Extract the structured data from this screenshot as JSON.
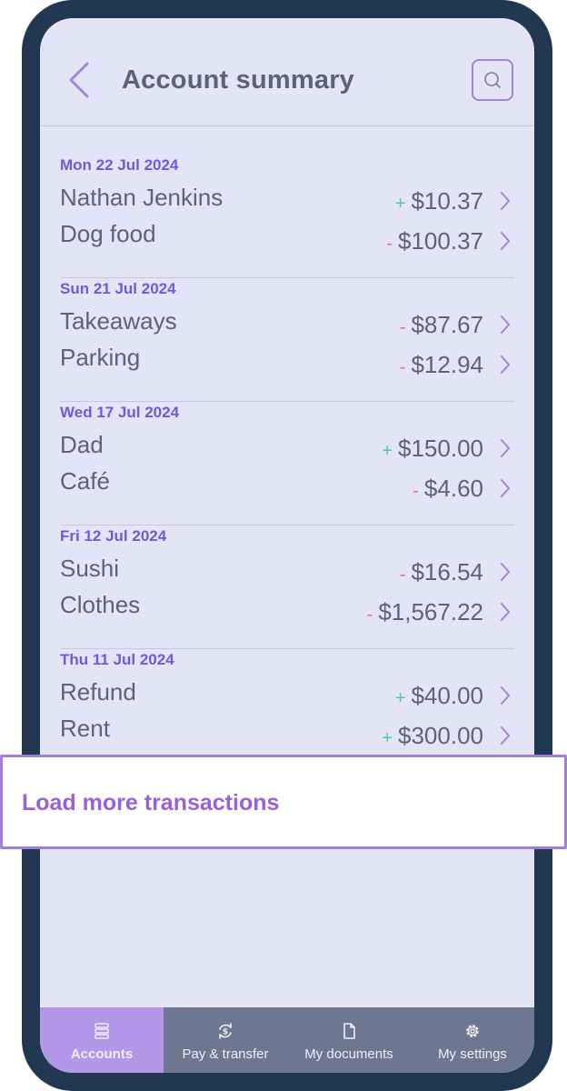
{
  "header": {
    "title": "Account summary"
  },
  "transactions": [
    {
      "date": "Mon 22 Jul 2024",
      "items": [
        {
          "name": "Nathan Jenkins",
          "sign": "+",
          "amount": "$10.37",
          "type": "pos"
        },
        {
          "name": "Dog food",
          "sign": "-",
          "amount": "$100.37",
          "type": "neg"
        }
      ]
    },
    {
      "date": "Sun 21 Jul 2024",
      "items": [
        {
          "name": "Takeaways",
          "sign": "-",
          "amount": "$87.67",
          "type": "neg"
        },
        {
          "name": "Parking",
          "sign": "-",
          "amount": "$12.94",
          "type": "neg"
        }
      ]
    },
    {
      "date": "Wed 17 Jul 2024",
      "items": [
        {
          "name": "Dad",
          "sign": "+",
          "amount": "$150.00",
          "type": "pos"
        },
        {
          "name": "Café",
          "sign": "-",
          "amount": "$4.60",
          "type": "neg"
        }
      ]
    },
    {
      "date": "Fri 12 Jul 2024",
      "items": [
        {
          "name": "Sushi",
          "sign": "-",
          "amount": "$16.54",
          "type": "neg"
        },
        {
          "name": "Clothes",
          "sign": "-",
          "amount": "$1,567.22",
          "type": "neg"
        }
      ]
    },
    {
      "date": "Thu 11 Jul 2024",
      "items": [
        {
          "name": "Refund",
          "sign": "+",
          "amount": "$40.00",
          "type": "pos"
        },
        {
          "name": "Rent",
          "sign": "+",
          "amount": "$300.00",
          "type": "pos"
        }
      ]
    }
  ],
  "load_more": {
    "label": "Load more transactions"
  },
  "tabbar": {
    "tabs": [
      {
        "label": "Accounts",
        "icon": "list-icon",
        "active": true
      },
      {
        "label": "Pay & transfer",
        "icon": "dollar-exchange-icon",
        "active": false
      },
      {
        "label": "My documents",
        "icon": "document-icon",
        "active": false
      },
      {
        "label": "My settings",
        "icon": "gear-icon",
        "active": false
      }
    ]
  },
  "colors": {
    "accent": "#a384dc",
    "date_text": "#7358d9",
    "positive": "#4fc7a8",
    "negative": "#e76b91",
    "tab_active": "#b397e8",
    "tab_bar": "#6d7792",
    "frame": "#213752",
    "screen_bg": "#e4e4f7"
  }
}
